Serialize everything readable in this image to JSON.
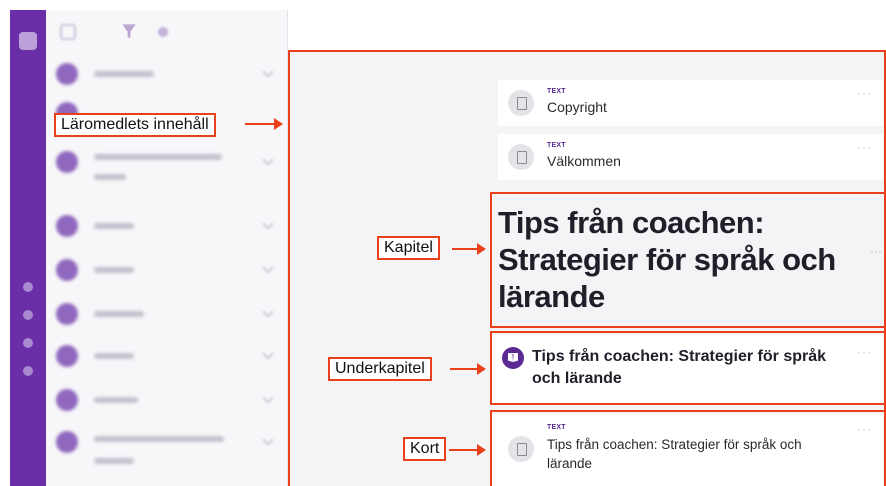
{
  "content": {
    "cards": [
      {
        "type": "TEXT",
        "title": "Copyright",
        "menu": "···"
      },
      {
        "type": "TEXT",
        "title": "Välkommen",
        "menu": "···"
      }
    ],
    "chapter": {
      "title": "Tips från coachen: Strategier för språk och lärande",
      "menu": "···"
    },
    "subchapter": {
      "title": "Tips från coachen: Strategier för språk och lärande",
      "menu": "···",
      "icon": "book-icon"
    },
    "card_bottom": {
      "type": "TEXT",
      "title": "Tips från coachen: Strategier för språk och lärande",
      "menu": "···"
    }
  },
  "annotations": {
    "content_label": "Läromedlets innehåll",
    "chapter_label": "Kapitel",
    "subchapter_label": "Underkapitel",
    "card_label": "Kort",
    "color": "#e8411a"
  },
  "theme": {
    "accent": "#6a2fa6",
    "type_color": "#5b2a92"
  }
}
